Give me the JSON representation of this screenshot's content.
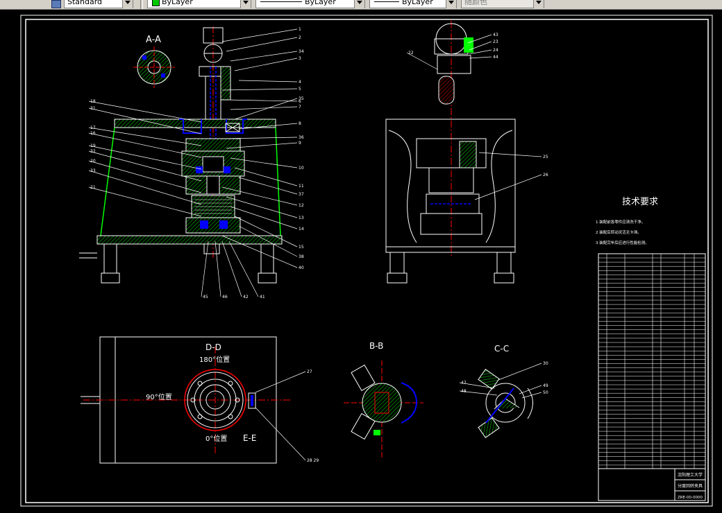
{
  "toolbar": {
    "text_style": "Standard",
    "layer": "ByLayer",
    "linetype": "ByLayer",
    "lineweight": "ByLayer",
    "plot_style": "随颜色",
    "layer_color": "#00c800"
  },
  "drawing": {
    "section_aa": "A-A",
    "section_bb": "B-B",
    "section_cc": "C-C",
    "section_dd": "D-D",
    "section_ee": "E-E",
    "pos_180": "180°位置",
    "pos_90": "90°位置",
    "pos_0": "0°位置",
    "tech_title": "技术要求",
    "tech_notes": [
      "1 装配前各零件应清洗干净。",
      "2 装配后转动灵活无卡滞。",
      "3 装配完毕后应进行性能检测。"
    ],
    "front_labels_right": [
      "1",
      "2",
      "34",
      "3",
      "4",
      "5",
      "6",
      "7",
      "35",
      "8",
      "36",
      "9",
      "10",
      "11",
      "37",
      "12",
      "13",
      "14",
      "15",
      "38",
      "40"
    ],
    "front_labels_left": [
      "18",
      "31",
      "17",
      "16",
      "19",
      "32",
      "20",
      "33",
      "21"
    ],
    "front_labels_bottom": [
      "45",
      "46",
      "42",
      "41"
    ],
    "side_labels": [
      "22",
      "43",
      "23",
      "24",
      "44",
      "25",
      "26"
    ],
    "de_labels": [
      "27",
      "28 29"
    ],
    "cc_labels": [
      "30",
      "47",
      "48",
      "49",
      "50"
    ],
    "title_block": [
      "沈阳理工大学",
      "分度回转夹具",
      "ZRE-00-0000"
    ],
    "colors": {
      "green": "#00ff00",
      "blue": "#0000ff",
      "red": "#ff0000",
      "white": "#ffffff",
      "hatch": "#00ff00"
    }
  }
}
